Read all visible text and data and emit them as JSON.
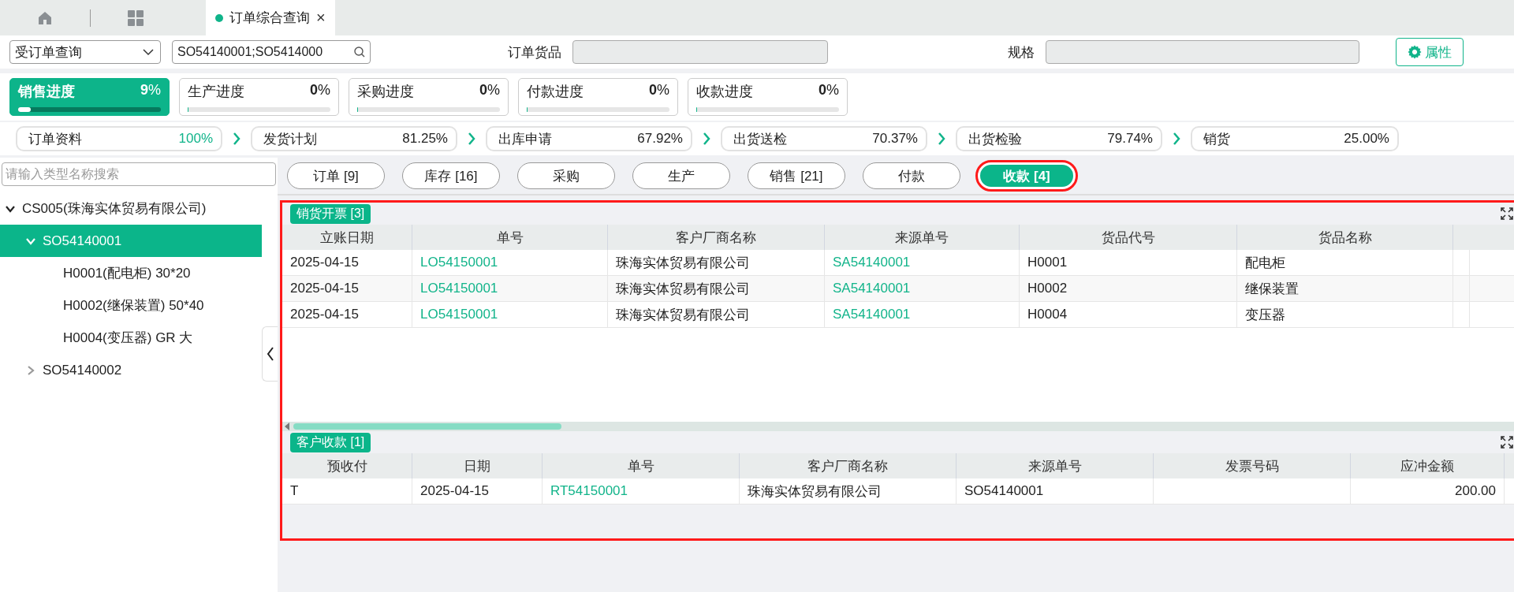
{
  "tabbar": {
    "tabs": [
      {
        "label": "订单综合查询",
        "close": "×",
        "selected": true
      }
    ]
  },
  "toolbar": {
    "query_type": "受订单查询",
    "search_value": "SO54140001;SO5414000",
    "fields": [
      {
        "label": "订单货品"
      },
      {
        "label": "规格"
      }
    ],
    "property_button": "属性"
  },
  "progress_cards": [
    {
      "label": "销售进度",
      "value": "**9**%",
      "level": 0.09,
      "selected": true
    },
    {
      "label": "生产进度",
      "value": "**0**%",
      "level": 0,
      "selected": false
    },
    {
      "label": "采购进度",
      "value": "**0**%",
      "level": 0,
      "selected": false
    },
    {
      "label": "付款进度",
      "value": "**0**%",
      "level": 0,
      "selected": false
    },
    {
      "label": "收款进度",
      "value": "**0**%",
      "level": 0,
      "selected": false
    }
  ],
  "stages": [
    {
      "label": "订单资料",
      "value": "100%",
      "complete": true
    },
    {
      "label": "发货计划",
      "value": "81.25%",
      "complete": false
    },
    {
      "label": "出库申请",
      "value": "67.92%",
      "complete": false
    },
    {
      "label": "出货送检",
      "value": "70.37%",
      "complete": false
    },
    {
      "label": "出货检验",
      "value": "79.74%",
      "complete": false
    },
    {
      "label": "销货",
      "value": "25.00%",
      "complete": false
    }
  ],
  "sidebar": {
    "search_placeholder": "请输入类型名称搜索",
    "tree": [
      {
        "label": "CS005(珠海实体贸易有限公司)",
        "expanded": true,
        "selected": false,
        "children": [
          {
            "label": "SO54140001",
            "expanded": true,
            "selected": true,
            "children": [
              {
                "label": "H0001(配电柜) 30*20",
                "selected": false
              },
              {
                "label": "H0002(继保装置) 50*40",
                "selected": false
              },
              {
                "label": "H0004(变压器) GR 大",
                "selected": false
              }
            ]
          },
          {
            "label": "SO54140002",
            "expanded": false,
            "selected": false
          }
        ]
      }
    ]
  },
  "detail_tabs": [
    {
      "label": "订单 [9]",
      "selected": false
    },
    {
      "label": "库存 [16]",
      "selected": false
    },
    {
      "label": "采购",
      "selected": false
    },
    {
      "label": "生产",
      "selected": false
    },
    {
      "label": "销售 [21]",
      "selected": false
    },
    {
      "label": "付款",
      "selected": false
    },
    {
      "label": "收款 [4]",
      "selected": true
    }
  ],
  "sections": [
    {
      "title": "销货开票 [3]",
      "scrollbar": true,
      "columns": [
        {
          "label": "立账日期",
          "kind": "text"
        },
        {
          "label": "单号",
          "kind": "link"
        },
        {
          "label": "客户厂商名称",
          "kind": "text"
        },
        {
          "label": "来源单号",
          "kind": "link"
        },
        {
          "label": "货品代号",
          "kind": "text"
        },
        {
          "label": "货品名称",
          "kind": "text"
        }
      ],
      "rows": [
        [
          "2025-04-15",
          "LO54150001",
          "珠海实体贸易有限公司",
          "SA54140001",
          "H0001",
          "配电柜"
        ],
        [
          "2025-04-15",
          "LO54150001",
          "珠海实体贸易有限公司",
          "SA54140001",
          "H0002",
          "继保装置"
        ],
        [
          "2025-04-15",
          "LO54150001",
          "珠海实体贸易有限公司",
          "SA54140001",
          "H0004",
          "变压器"
        ]
      ]
    },
    {
      "title": "客户收款 [1]",
      "scrollbar": false,
      "columns": [
        {
          "label": "预收付",
          "kind": "text"
        },
        {
          "label": "日期",
          "kind": "text"
        },
        {
          "label": "单号",
          "kind": "link"
        },
        {
          "label": "客户厂商名称",
          "kind": "text"
        },
        {
          "label": "来源单号",
          "kind": "text"
        },
        {
          "label": "发票号码",
          "kind": "text"
        },
        {
          "label": "应冲金额",
          "kind": "number"
        }
      ],
      "rows": [
        [
          "T",
          "2025-04-15",
          "RT54150001",
          "珠海实体贸易有限公司",
          "SO54140001",
          null,
          "200.00"
        ]
      ]
    }
  ]
}
